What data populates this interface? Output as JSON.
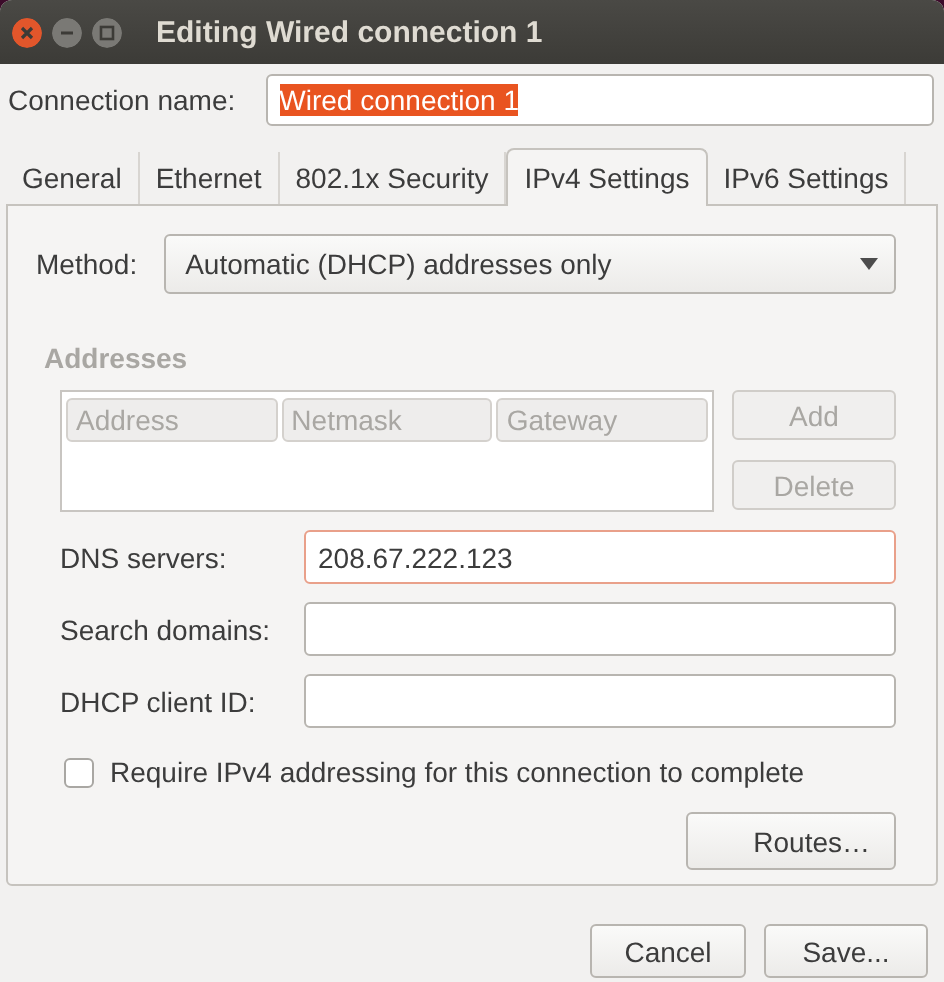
{
  "window": {
    "title": "Editing Wired connection 1"
  },
  "connection_name": {
    "label": "Connection name:",
    "value": "Wired connection 1",
    "text_selected": true
  },
  "tabs": [
    {
      "label": "General",
      "selected": false
    },
    {
      "label": "Ethernet",
      "selected": false
    },
    {
      "label": "802.1x Security",
      "selected": false
    },
    {
      "label": "IPv4 Settings",
      "selected": true
    },
    {
      "label": "IPv6 Settings",
      "selected": false
    }
  ],
  "method": {
    "label": "Method:",
    "value": "Automatic (DHCP) addresses only"
  },
  "addresses": {
    "title": "Addresses",
    "disabled": true,
    "columns": [
      "Address",
      "Netmask",
      "Gateway"
    ],
    "buttons": [
      {
        "label": "Add",
        "disabled": true
      },
      {
        "label": "Delete",
        "disabled": true
      }
    ]
  },
  "fields": [
    {
      "label": "DNS servers:",
      "value": "208.67.222.123",
      "focused": true
    },
    {
      "label": "Search domains:",
      "focused": false
    },
    {
      "label": "DHCP client ID:",
      "focused": false
    }
  ],
  "require_checkbox": {
    "label": "Require IPv4 addressing for this connection to complete",
    "checked": false
  },
  "routes_button": {
    "label": "Routes…"
  },
  "buttons": [
    {
      "label": "Cancel"
    },
    {
      "label": "Save..."
    }
  ]
}
